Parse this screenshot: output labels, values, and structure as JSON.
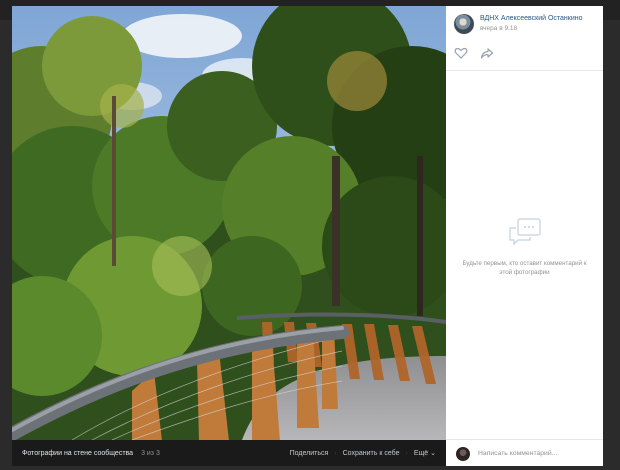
{
  "viewer": {
    "bottombar": {
      "album": "Фотографии на стене сообщества",
      "counter": "3 из 3",
      "share": "Поделиться",
      "save": "Сохранить к себе",
      "more": "Ещё"
    }
  },
  "post": {
    "author": "ВДНХ Алексеевский Останкино",
    "date": "вчера в 9:18",
    "like_icon": "heart-icon",
    "share_icon": "share-arrow-icon"
  },
  "comments": {
    "empty_icon": "comments-bubble-icon",
    "empty_text": "Будьте первым, кто оставит комментарий к этой фотографии",
    "input_placeholder": "Написать комментарий..."
  },
  "colors": {
    "link": "#2a5885",
    "muted": "#939393",
    "viewer_bg": "#1a1a1a"
  }
}
